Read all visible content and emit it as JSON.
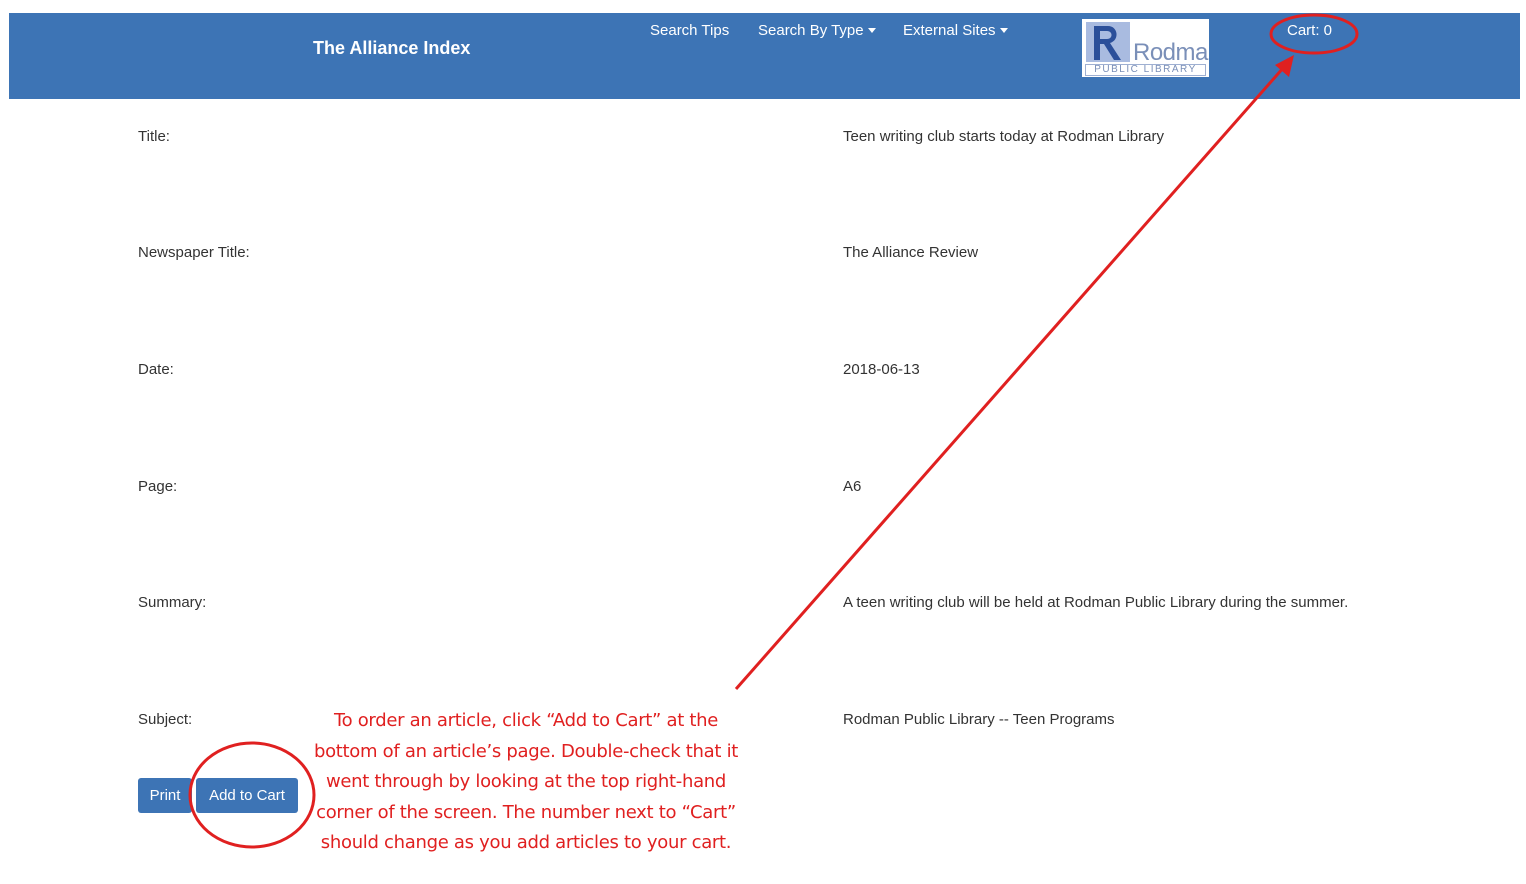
{
  "header": {
    "brand": "The Alliance Index",
    "nav": {
      "search_tips": "Search Tips",
      "search_by_type": "Search By Type",
      "external_sites": "External Sites"
    },
    "logo": {
      "name": "Rodman",
      "subtitle": "PUBLIC LIBRARY"
    },
    "cart": "Cart: 0"
  },
  "record": {
    "fields": [
      {
        "label": "Title:",
        "value": "Teen writing club starts today at Rodman Library"
      },
      {
        "label": "Newspaper Title:",
        "value": "The Alliance Review"
      },
      {
        "label": "Date:",
        "value": "2018-06-13"
      },
      {
        "label": "Page:",
        "value": "A6"
      },
      {
        "label": "Summary:",
        "value": "A teen writing club will be held at Rodman Public Library during the summer."
      },
      {
        "label": "Subject:",
        "value": "Rodman Public Library -- Teen Programs"
      }
    ]
  },
  "actions": {
    "print": "Print",
    "add_to_cart": "Add to Cart"
  },
  "annotation": {
    "lines": [
      "To order an article, click “Add to Cart” at the",
      "bottom of an article’s page. Double-check that it",
      "went through by looking at the top right-hand",
      "corner of the screen. The number next to “Cart”",
      "should change as you add articles to your cart."
    ],
    "color": "#e02020"
  },
  "theme": {
    "navbar": "#3d74b5",
    "button": "#3d74b5",
    "text": "#333333"
  }
}
